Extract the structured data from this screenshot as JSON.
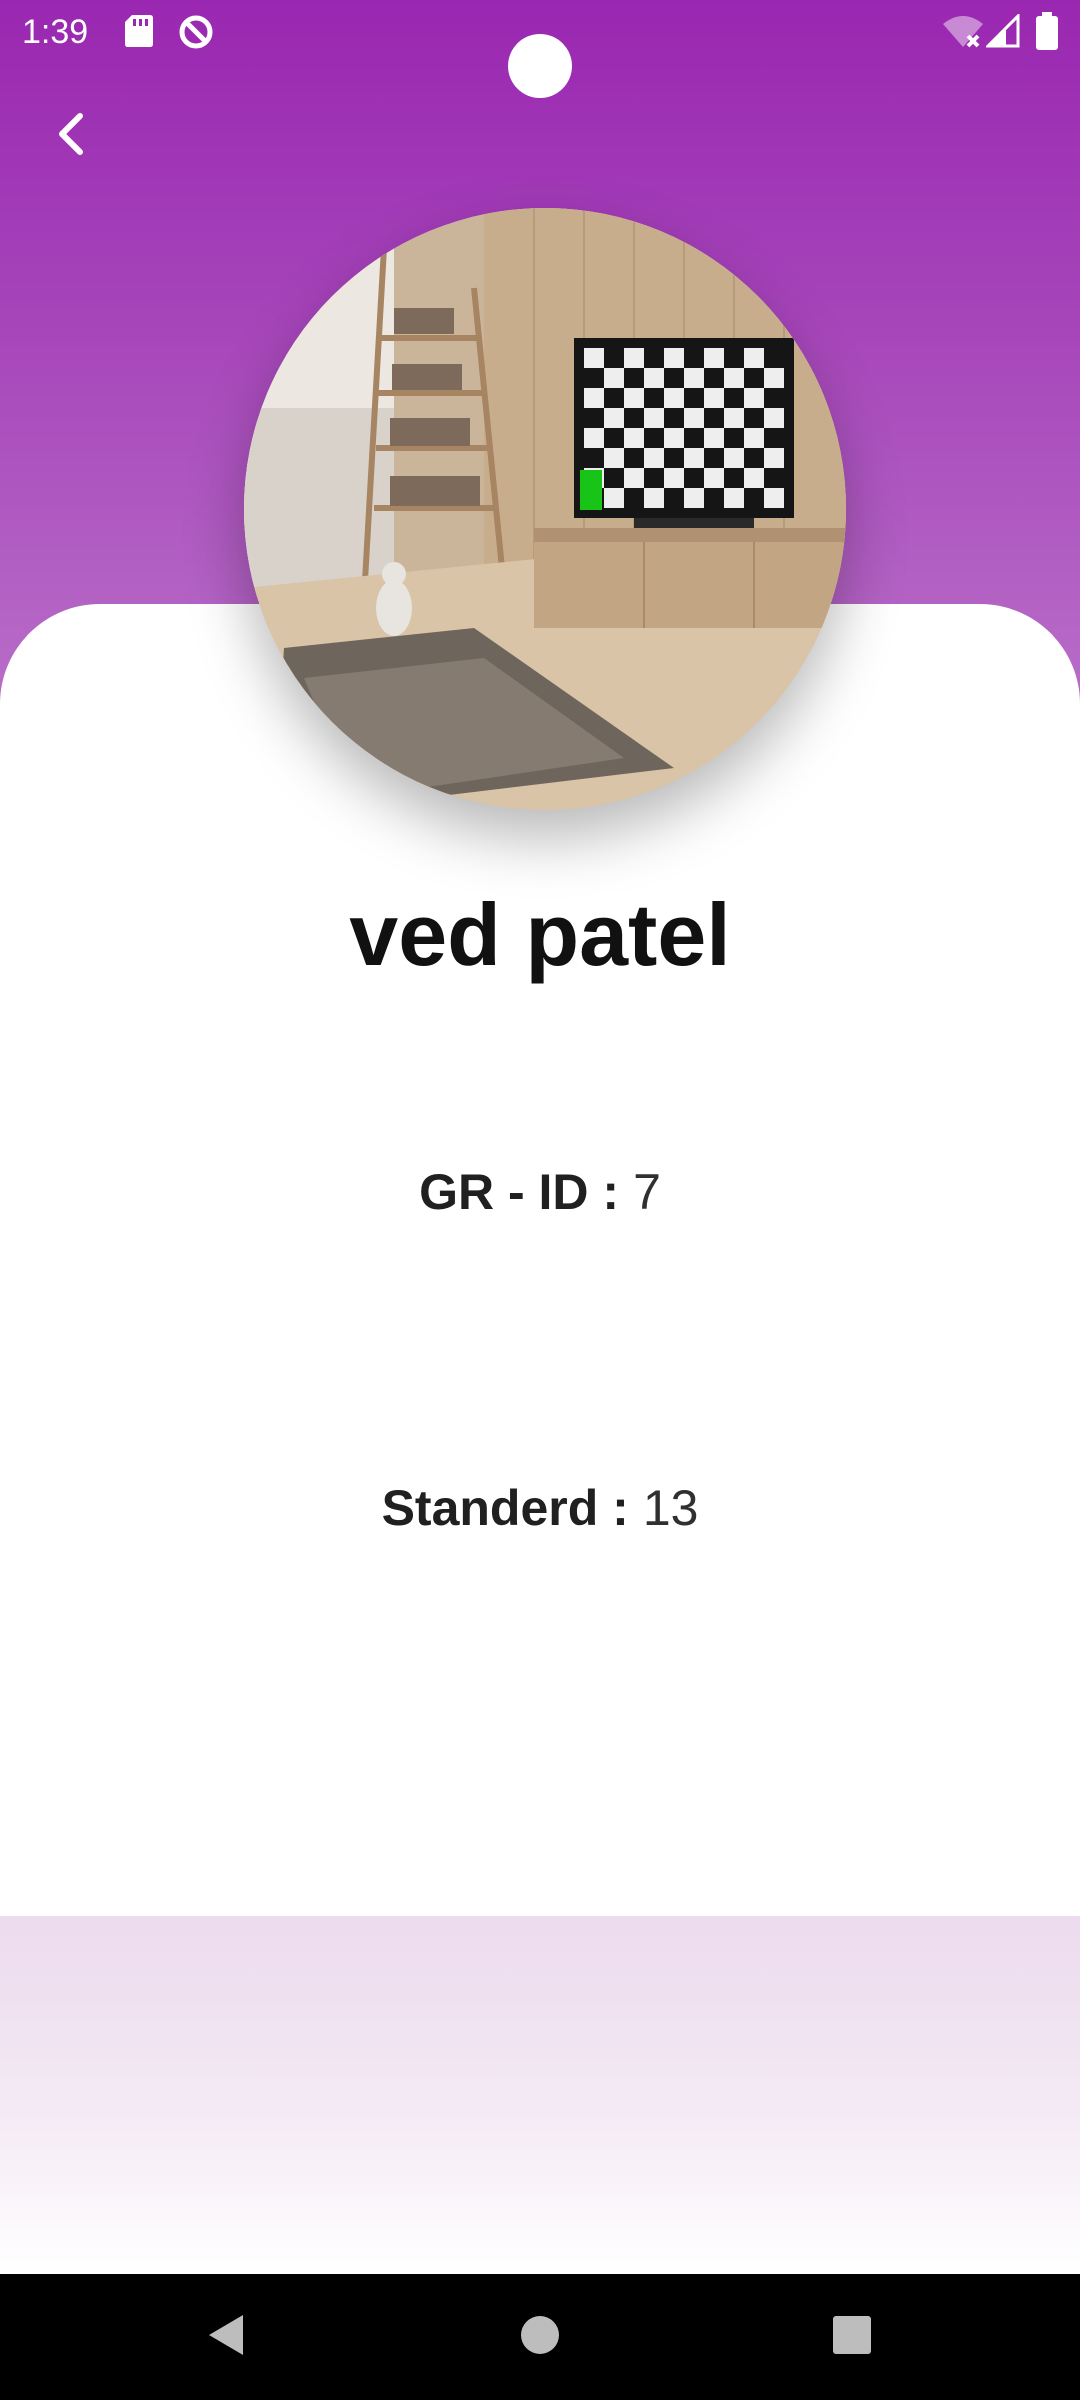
{
  "status_bar": {
    "time": "1:39",
    "icons": [
      "sd-card-icon",
      "data-saver-icon",
      "wifi-off-icon",
      "signal-icon",
      "battery-icon"
    ]
  },
  "profile": {
    "name": "ved patel",
    "avatar_desc": "avatar-photo"
  },
  "details": {
    "gr_id_label": "GR - ID :",
    "gr_id_value": "7",
    "standard_label": "Standerd :",
    "standard_value": "13"
  },
  "colors": {
    "header_top": "#9a27b1",
    "header_bottom": "#b96fc9",
    "bottom_fade": "#ecdbee"
  },
  "nav": {
    "icons": [
      "back-triangle-icon",
      "home-circle-icon",
      "recents-square-icon"
    ]
  }
}
